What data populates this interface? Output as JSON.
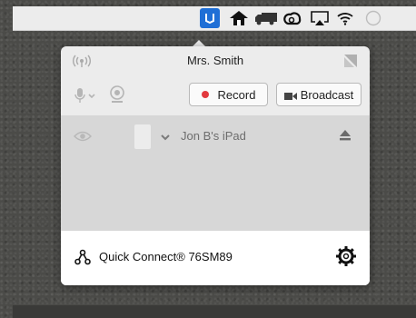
{
  "menubar": {
    "icons": [
      "app-icon",
      "home-icon",
      "truck-icon",
      "creative-cloud-icon",
      "airplay-icon",
      "wifi-icon",
      "notification-icon"
    ]
  },
  "popover": {
    "title": "Mrs. Smith",
    "record_label": "Record",
    "broadcast_label": "Broadcast",
    "device": {
      "name": "Jon B's iPad"
    },
    "footer": {
      "quick_connect_label": "Quick Connect® 76SM89"
    }
  },
  "colors": {
    "record_dot": "#e2393e",
    "app_icon_bg": "#1f6fd6",
    "popover_bg": "#ececec",
    "device_area_bg": "#d7d7d7"
  }
}
